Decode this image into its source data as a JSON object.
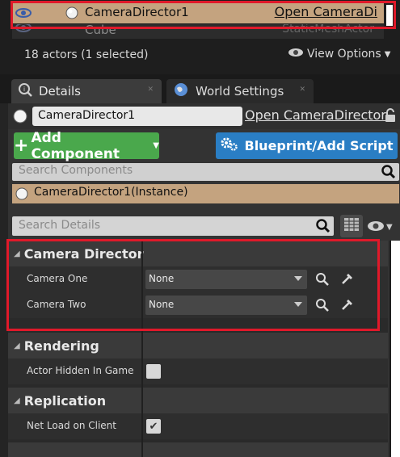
{
  "outliner": {
    "selected_row": {
      "name": "CameraDirector1",
      "type_link": "Open CameraDi"
    },
    "partial_row": {
      "name": "Cube",
      "type": "StaticMeshActor"
    },
    "actor_count": "18 actors (1 selected)",
    "view_options": "View Options"
  },
  "tabs": [
    {
      "label": "Details"
    },
    {
      "label": "World Settings"
    }
  ],
  "details": {
    "actor_name": "CameraDirector1",
    "open_link": "Open CameraDirector",
    "add_component": "Add Component",
    "blueprint_button": "Blueprint/Add Script",
    "search_components_placeholder": "Search Components",
    "instance_label": "CameraDirector1(Instance)",
    "search_details_placeholder": "Search Details"
  },
  "categories": {
    "camera_director": {
      "title": "Camera Director",
      "props": [
        {
          "label": "Camera One",
          "value": "None"
        },
        {
          "label": "Camera Two",
          "value": "None"
        }
      ]
    },
    "rendering": {
      "title": "Rendering",
      "props": [
        {
          "label": "Actor Hidden In Game",
          "checked": false
        }
      ]
    },
    "replication": {
      "title": "Replication",
      "props": [
        {
          "label": "Net Load on Client",
          "checked": true,
          "mark": "✔"
        }
      ]
    }
  },
  "colors": {
    "selection": "#c4a37f",
    "add_button": "#4aa84c",
    "blueprint_button": "#2a7ec4",
    "highlight": "#e0192a"
  }
}
